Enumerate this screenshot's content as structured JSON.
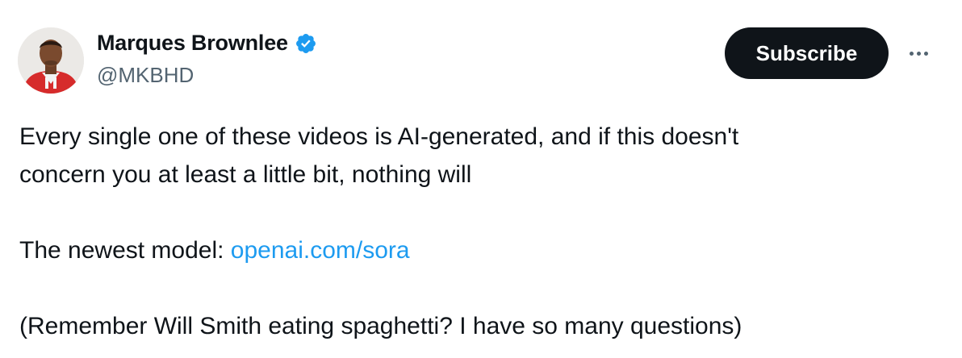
{
  "author": {
    "display_name": "Marques Brownlee",
    "handle": "@MKBHD",
    "verified": true,
    "avatar_icon": "profile-photo"
  },
  "actions": {
    "subscribe_label": "Subscribe",
    "more_icon": "more-dots-icon"
  },
  "tweet": {
    "line1": "Every single one of these videos is AI-generated, and if this doesn't",
    "line2": "concern you at least a little bit, nothing will",
    "model_prefix": "The newest model: ",
    "link_text": "openai.com/sora",
    "line4": "(Remember Will Smith eating spaghetti? I have so many questions)"
  },
  "colors": {
    "text": "#0f1419",
    "secondary": "#536471",
    "link": "#1d9bf0",
    "verified_badge": "#1d9bf0",
    "button_bg": "#0f1419"
  }
}
